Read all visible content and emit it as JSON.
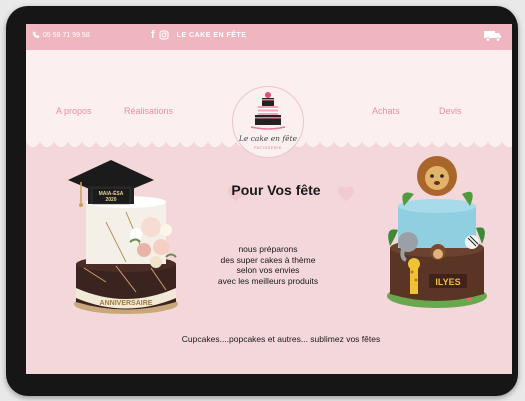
{
  "topbar": {
    "phone": "05 59 71 59 58",
    "social": {
      "facebook_icon": "facebook-icon",
      "instagram_icon": "instagram-icon"
    },
    "brand": "LE CAKE EN FÊTE",
    "cart_icon": "truck-icon"
  },
  "nav": {
    "apropos": "A propos",
    "realisations": "Réalisations",
    "achats": "Achats",
    "devis": "Devis"
  },
  "logo": {
    "script": "Le cake en fête",
    "sub": "PATISSERIE"
  },
  "hero": {
    "title": "Pour Vos fête",
    "lines": [
      "nous préparons",
      "des super cakes à thème",
      "selon vos envies",
      "avec les meilleurs produits"
    ],
    "tagline": "Cupcakes....popcakes et autres...   sublimez vos fêtes"
  },
  "left_cake": {
    "sign": [
      "MAIA-ÉSA",
      "2020"
    ],
    "ribbon": "ANNIVERSAIRE"
  },
  "right_cake": {
    "name": "ILYES"
  },
  "colors": {
    "topbar": "#f0b6c0",
    "nav_bg": "#fbeff0",
    "page_bg": "#f3d7da",
    "link": "#e8909e"
  }
}
